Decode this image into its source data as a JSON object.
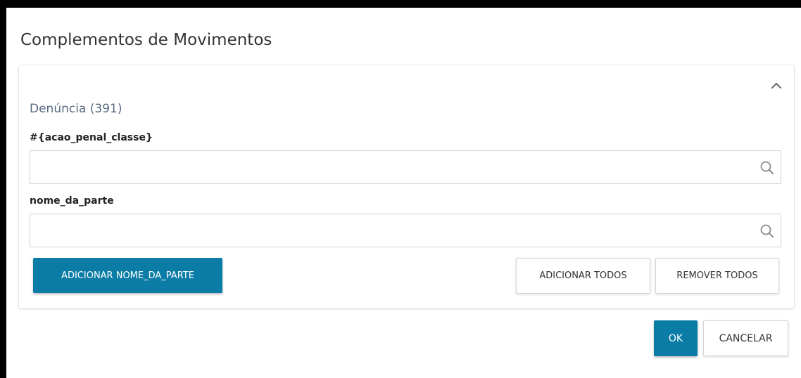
{
  "dialog": {
    "title": "Complementos de Movimentos"
  },
  "panel": {
    "section_title": "Denúncia (391)",
    "collapse_icon": "chevron-up-icon",
    "fields": [
      {
        "label": "#{acao_penal_classe}",
        "value": "",
        "icon": "search-icon"
      },
      {
        "label": "nome_da_parte",
        "value": "",
        "icon": "search-icon"
      }
    ],
    "buttons": {
      "add_part": "ADICIONAR NOME_DA_PARTE",
      "add_all": "ADICIONAR TODOS",
      "remove_all": "REMOVER TODOS"
    }
  },
  "footer": {
    "ok_label": "OK",
    "cancel_label": "CANCELAR"
  },
  "colors": {
    "primary": "#0b7ca6",
    "section_title": "#5a6a80",
    "frame": "#000000"
  }
}
